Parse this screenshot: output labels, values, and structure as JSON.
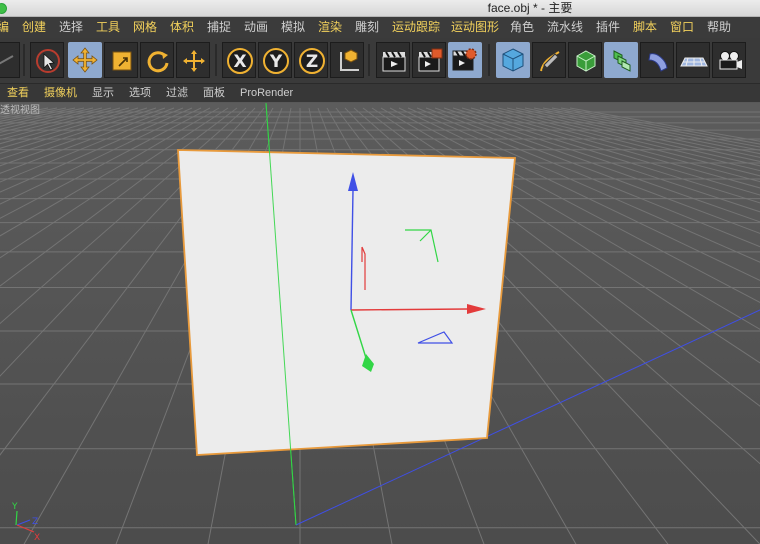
{
  "window": {
    "title": "face.obj * - 主要"
  },
  "menu": [
    {
      "label": "编",
      "color": "#f2d15c"
    },
    {
      "label": "创建",
      "color": "#f2d15c"
    },
    {
      "label": "选择",
      "color": "#cfcfcf"
    },
    {
      "label": "工具",
      "color": "#f2d15c"
    },
    {
      "label": "网格",
      "color": "#f2d15c"
    },
    {
      "label": "体积",
      "color": "#f2d15c"
    },
    {
      "label": "捕捉",
      "color": "#cfcfcf"
    },
    {
      "label": "动画",
      "color": "#cfcfcf"
    },
    {
      "label": "模拟",
      "color": "#cfcfcf"
    },
    {
      "label": "渲染",
      "color": "#f2d15c"
    },
    {
      "label": "雕刻",
      "color": "#cfcfcf"
    },
    {
      "label": "运动跟踪",
      "color": "#f2d15c"
    },
    {
      "label": "运动图形",
      "color": "#f2d15c"
    },
    {
      "label": "角色",
      "color": "#cfcfcf"
    },
    {
      "label": "流水线",
      "color": "#cfcfcf"
    },
    {
      "label": "插件",
      "color": "#cfcfcf"
    },
    {
      "label": "脚本",
      "color": "#f2d15c"
    },
    {
      "label": "窗口",
      "color": "#f2d15c"
    },
    {
      "label": "帮助",
      "color": "#cfcfcf"
    }
  ],
  "view_menu": [
    {
      "label": "查看",
      "color": "#f2d15c"
    },
    {
      "label": "摄像机",
      "color": "#f2d15c"
    },
    {
      "label": "显示",
      "color": "#cfcfcf"
    },
    {
      "label": "选项",
      "color": "#cfcfcf"
    },
    {
      "label": "过滤",
      "color": "#cfcfcf"
    },
    {
      "label": "面板",
      "color": "#cfcfcf"
    },
    {
      "label": "ProRender",
      "color": "#cfcfcf"
    }
  ],
  "viewport": {
    "label": "透视视图"
  },
  "axis_labels": {
    "y": "Y",
    "z": "Z",
    "x": "X"
  },
  "colors": {
    "face_fill": "#ececec",
    "face_outline": "#e89a3c",
    "axis_x": "#e33b3b",
    "axis_y": "#3f4fe6",
    "axis_z": "#32d646",
    "grid_line": "#747474",
    "background_top": "#5c5c5c",
    "background_bottom": "#4c4c4c"
  }
}
